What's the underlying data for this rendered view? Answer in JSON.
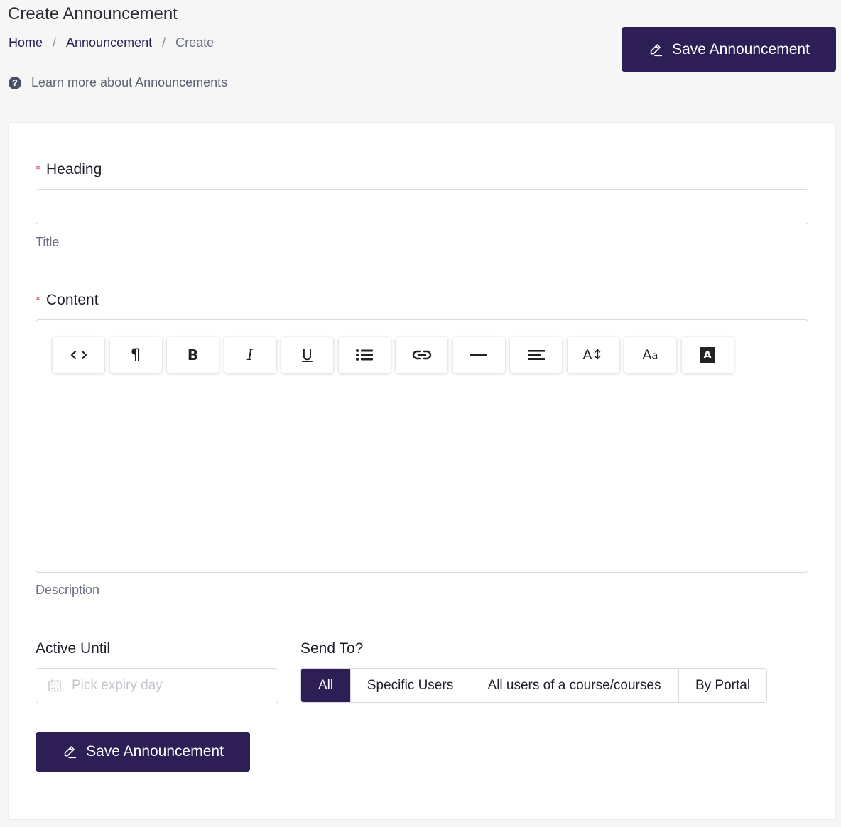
{
  "page": {
    "title": "Create Announcement"
  },
  "breadcrumb": {
    "items": [
      "Home",
      "Announcement",
      "Create"
    ],
    "separator": "/"
  },
  "help": {
    "icon": "question-circle-icon",
    "label": "Learn more about Announcements"
  },
  "actions": {
    "save_label": "Save Announcement",
    "save_icon": "edit-pen-icon"
  },
  "form": {
    "heading": {
      "label": "Heading",
      "required": true,
      "value": "",
      "helper": "Title"
    },
    "content": {
      "label": "Content",
      "required": true,
      "value": "",
      "helper": "Description",
      "toolbar": [
        {
          "name": "code-view-icon",
          "glyph": "<>"
        },
        {
          "name": "paragraph-icon",
          "glyph": "¶"
        },
        {
          "name": "bold-icon",
          "glyph": "B"
        },
        {
          "name": "italic-icon",
          "glyph": "I"
        },
        {
          "name": "underline-icon",
          "glyph": "U"
        },
        {
          "name": "bullet-list-icon",
          "glyph": "list"
        },
        {
          "name": "link-icon",
          "glyph": "link"
        },
        {
          "name": "horizontal-rule-icon",
          "glyph": "hr"
        },
        {
          "name": "align-left-icon",
          "glyph": "align"
        },
        {
          "name": "font-size-icon",
          "glyph": "A↕"
        },
        {
          "name": "font-family-icon",
          "glyph": "Aa"
        },
        {
          "name": "text-color-icon",
          "glyph": "A"
        }
      ]
    },
    "active_until": {
      "label": "Active Until",
      "placeholder": "Pick expiry day",
      "value": "",
      "icon": "calendar-icon"
    },
    "send_to": {
      "label": "Send To?",
      "options": [
        "All",
        "Specific Users",
        "All users of a course/courses",
        "By Portal"
      ],
      "selected": "All"
    }
  },
  "colors": {
    "primary": "#2d1f56",
    "required": "#e25555",
    "background": "#f6f6f6"
  }
}
